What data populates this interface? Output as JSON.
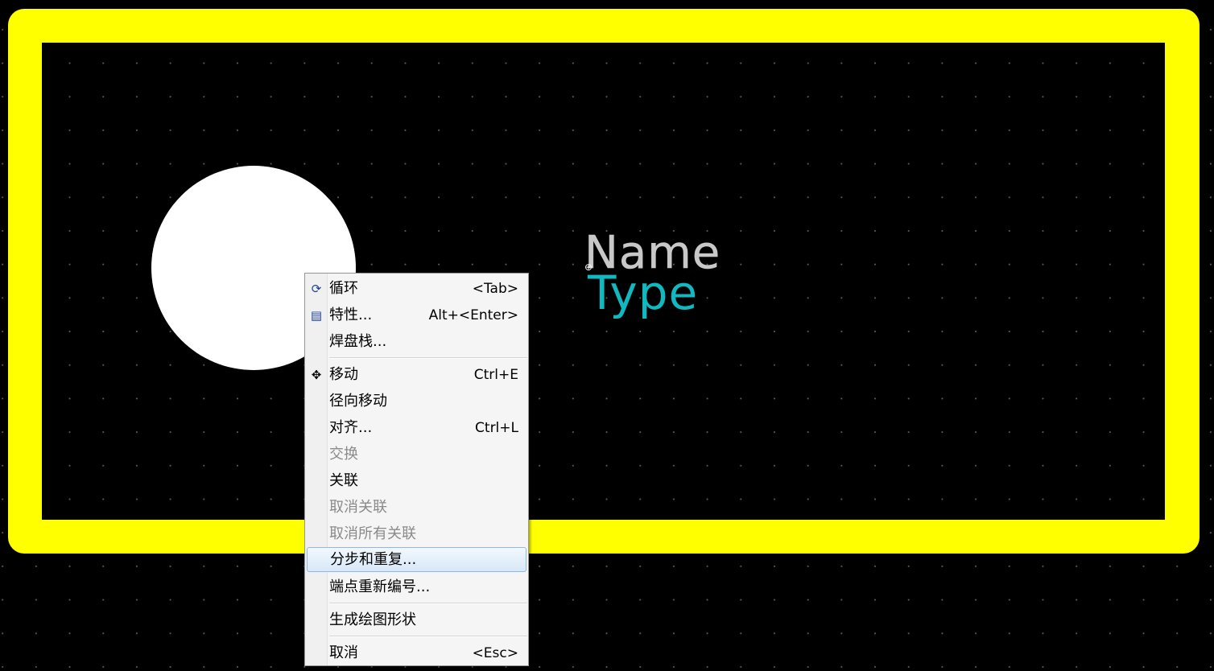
{
  "board": {
    "name_label": "Name",
    "type_label": "Type",
    "colors": {
      "outline": "#ffff00",
      "background": "#000000",
      "pad": "#ffffff",
      "name_text": "#c8c8c8",
      "type_text": "#10b8c0",
      "grid_dot": "#5a5a5a"
    }
  },
  "context_menu": {
    "items": [
      {
        "label": "循环",
        "shortcut": "<Tab>",
        "icon": "cycle-icon",
        "disabled": false
      },
      {
        "label": "特性...",
        "shortcut": "Alt+<Enter>",
        "icon": "properties-icon",
        "disabled": false
      },
      {
        "label": "焊盘栈...",
        "shortcut": "",
        "icon": "",
        "disabled": false
      },
      {
        "label": "移动",
        "shortcut": "Ctrl+E",
        "icon": "move-icon",
        "disabled": false
      },
      {
        "label": "径向移动",
        "shortcut": "",
        "icon": "",
        "disabled": false
      },
      {
        "label": "对齐...",
        "shortcut": "Ctrl+L",
        "icon": "",
        "disabled": false
      },
      {
        "label": "交换",
        "shortcut": "",
        "icon": "",
        "disabled": true
      },
      {
        "label": "关联",
        "shortcut": "",
        "icon": "",
        "disabled": false
      },
      {
        "label": "取消关联",
        "shortcut": "",
        "icon": "",
        "disabled": true
      },
      {
        "label": "取消所有关联",
        "shortcut": "",
        "icon": "",
        "disabled": true
      },
      {
        "label": "分步和重复...",
        "shortcut": "",
        "icon": "",
        "disabled": false,
        "highlighted": true
      },
      {
        "label": "端点重新编号...",
        "shortcut": "",
        "icon": "",
        "disabled": false
      },
      {
        "label": "生成绘图形状",
        "shortcut": "",
        "icon": "",
        "disabled": false
      },
      {
        "label": "取消",
        "shortcut": "<Esc>",
        "icon": "",
        "disabled": false
      }
    ]
  }
}
